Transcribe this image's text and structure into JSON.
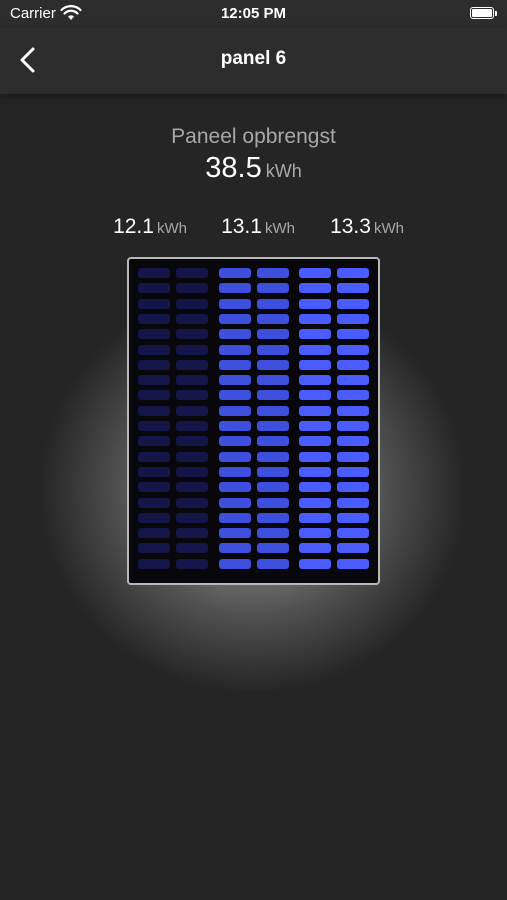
{
  "status_bar": {
    "carrier": "Carrier",
    "time": "12:05 PM",
    "wifi_icon": "wifi-icon",
    "battery_icon": "battery-icon"
  },
  "nav": {
    "back_icon": "chevron-left-icon",
    "title": "panel 6"
  },
  "summary": {
    "label": "Paneel opbrengst",
    "total_value": "38.5",
    "total_unit": "kWh"
  },
  "strings": [
    {
      "value": "12.1",
      "unit": "kWh",
      "color": "#14164a"
    },
    {
      "value": "13.1",
      "unit": "kWh",
      "color": "#3d4fdc"
    },
    {
      "value": "13.3",
      "unit": "kWh",
      "color": "#4a5cff"
    }
  ],
  "panel": {
    "rows": 20,
    "columns_per_string": 2
  }
}
